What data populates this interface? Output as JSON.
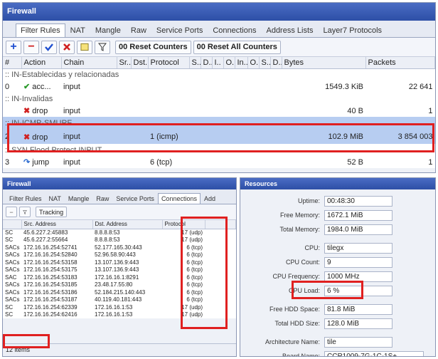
{
  "firewall": {
    "title": "Firewall",
    "tabs": [
      "Filter Rules",
      "NAT",
      "Mangle",
      "Raw",
      "Service Ports",
      "Connections",
      "Address Lists",
      "Layer7 Protocols"
    ],
    "reset_counters": "00 Reset Counters",
    "reset_all_counters": "00 Reset All Counters",
    "columns": [
      "#",
      "Action",
      "Chain",
      "Sr..",
      "Dst..",
      "Protocol",
      "S..",
      "D..",
      "I..",
      "O..",
      "In..",
      "O..",
      "S..",
      "D..",
      "Bytes",
      "Packets"
    ],
    "rows": [
      {
        "type": "comment",
        "text": ":: IN-Establecidas y relacionadas"
      },
      {
        "type": "rule",
        "num": "0",
        "action": "acc...",
        "chain": "input",
        "protocol": "",
        "bytes": "1549.3 KiB",
        "packets": "22 641"
      },
      {
        "type": "comment",
        "text": ":: IN-Invalidas"
      },
      {
        "type": "rule",
        "num": "",
        "action": "drop",
        "chain": "input",
        "protocol": "",
        "bytes": "40 B",
        "packets": "1"
      },
      {
        "type": "comment",
        "text": ":: IN-ICMP-SMURF"
      },
      {
        "type": "rule",
        "num": "2",
        "action": "drop",
        "chain": "input",
        "protocol": "1 (icmp)",
        "bytes": "102.9 MiB",
        "packets": "3 854 003"
      },
      {
        "type": "comment",
        "text": ":: SYN Flood Protect INPUT"
      },
      {
        "type": "rule",
        "num": "3",
        "action": "jump",
        "chain": "input",
        "protocol": "6 (tcp)",
        "bytes": "52 B",
        "packets": "1"
      }
    ]
  },
  "connections": {
    "title": "Firewall",
    "tabs": [
      "Filter Rules",
      "NAT",
      "Mangle",
      "Raw",
      "Service Ports",
      "Connections",
      "Add"
    ],
    "tracking_label": "Tracking",
    "columns": [
      "",
      "Src. Address",
      "Dst. Address",
      "Protocol"
    ],
    "rows": [
      {
        "flags": "SC",
        "src": "45.6.227.2:45883",
        "dst": "8.8.8.8:53",
        "proto": "17 (udp)"
      },
      {
        "flags": "SC",
        "src": "45.6.227.2:55664",
        "dst": "8.8.8.8:53",
        "proto": "17 (udp)"
      },
      {
        "flags": "SACs",
        "src": "172.16.16.254:52741",
        "dst": "52.177.165.30:443",
        "proto": "6 (tcp)"
      },
      {
        "flags": "SACs",
        "src": "172.16.16.254:52840",
        "dst": "52.96.58.90:443",
        "proto": "6 (tcp)"
      },
      {
        "flags": "SACs",
        "src": "172.16.16.254:53158",
        "dst": "13.107.136.9:443",
        "proto": "6 (tcp)"
      },
      {
        "flags": "SACs",
        "src": "172.16.16.254:53175",
        "dst": "13.107.136.9:443",
        "proto": "6 (tcp)"
      },
      {
        "flags": "SAC",
        "src": "172.16.16.254:53183",
        "dst": "172.16.16.1:8291",
        "proto": "6 (tcp)"
      },
      {
        "flags": "SACs",
        "src": "172.16.16.254:53185",
        "dst": "23.48.17.55:80",
        "proto": "6 (tcp)"
      },
      {
        "flags": "SACs",
        "src": "172.16.16.254:53186",
        "dst": "52.184.215.140:443",
        "proto": "6 (tcp)"
      },
      {
        "flags": "SACs",
        "src": "172.16.16.254:53187",
        "dst": "40.119.40.181:443",
        "proto": "6 (tcp)"
      },
      {
        "flags": "SC",
        "src": "172.16.16.254:62339",
        "dst": "172.16.16.1:53",
        "proto": "17 (udp)"
      },
      {
        "flags": "SC",
        "src": "172.16.16.254:62416",
        "dst": "172.16.16.1:53",
        "proto": "17 (udp)"
      }
    ],
    "item_count": "12 items"
  },
  "resources": {
    "title": "Resources",
    "fields": [
      {
        "label": "Uptime:",
        "value": "00:48:30"
      },
      {
        "label": "Free Memory:",
        "value": "1672.1 MiB"
      },
      {
        "label": "Total Memory:",
        "value": "1984.0 MiB"
      },
      {
        "label": "CPU:",
        "value": "tilegx"
      },
      {
        "label": "CPU Count:",
        "value": "9"
      },
      {
        "label": "CPU Frequency:",
        "value": "1000 MHz"
      },
      {
        "label": "CPU Load:",
        "value": "6 %"
      },
      {
        "label": "Free HDD Space:",
        "value": "81.8 MiB"
      },
      {
        "label": "Total HDD Size:",
        "value": "128.0 MiB"
      },
      {
        "label": "Architecture Name:",
        "value": "tile"
      },
      {
        "label": "Board Name:",
        "value": "CCR1009-7G-1C-1S+"
      }
    ]
  },
  "colors": {
    "highlight_red": "#e02020",
    "title_blue": "#2d4fa6",
    "selected_row": "#b7cdf1",
    "add_blue": "#1f4fd0",
    "remove_red": "#d02020"
  }
}
